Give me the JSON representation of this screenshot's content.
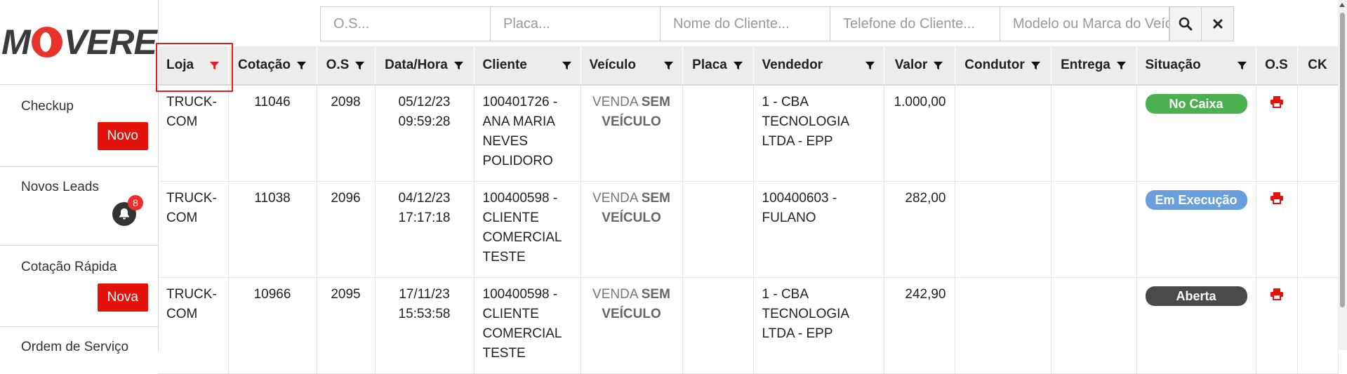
{
  "brand": {
    "logo_text_left": "M",
    "logo_text_right": "VERE"
  },
  "sidebar": {
    "items": [
      {
        "label": "Checkup",
        "button": "Novo"
      },
      {
        "label": "Novos Leads",
        "badge": "8"
      },
      {
        "label": "Cotação Rápida",
        "button": "Nova"
      },
      {
        "label": "Ordem de Serviço"
      }
    ]
  },
  "search": {
    "os_placeholder": "O.S...",
    "placa_placeholder": "Placa...",
    "cliente_placeholder": "Nome do Cliente...",
    "telefone_placeholder": "Telefone do Cliente...",
    "modelo_placeholder": "Modelo ou Marca do Veículo..."
  },
  "table": {
    "headers": [
      "Loja",
      "Cotação",
      "O.S",
      "Data/Hora",
      "Cliente",
      "Veículo",
      "Placa",
      "Vendedor",
      "Valor",
      "Condutor",
      "Entrega",
      "Situação",
      "O.S",
      "CK"
    ],
    "rows": [
      {
        "loja": "TRUCK-COM",
        "cotacao": "11046",
        "os": "2098",
        "data": "05/12/23",
        "hora": "09:59:28",
        "cliente": "100401726 - ANA MARIA NEVES POLIDORO",
        "veiculo_prefix": "VENDA",
        "veiculo_bold": "SEM VEÍCULO",
        "placa": "",
        "vendedor": "1 - CBA TECNOLOGIA LTDA - EPP",
        "valor": "1.000,00",
        "condutor": "",
        "entrega": "",
        "situacao": "No Caixa",
        "situacao_color": "#4caf50"
      },
      {
        "loja": "TRUCK-COM",
        "cotacao": "11038",
        "os": "2096",
        "data": "04/12/23",
        "hora": "17:17:18",
        "cliente": "100400598 - CLIENTE COMERCIAL TESTE",
        "veiculo_prefix": "VENDA",
        "veiculo_bold": "SEM VEÍCULO",
        "placa": "",
        "vendedor": "100400603 - FULANO",
        "valor": "282,00",
        "condutor": "",
        "entrega": "",
        "situacao": "Em Execução",
        "situacao_color": "#6a9fde"
      },
      {
        "loja": "TRUCK-COM",
        "cotacao": "10966",
        "os": "2095",
        "data": "17/11/23",
        "hora": "15:53:58",
        "cliente": "100400598 - CLIENTE COMERCIAL TESTE",
        "veiculo_prefix": "VENDA",
        "veiculo_bold": "SEM VEÍCULO",
        "placa": "",
        "vendedor": "1 - CBA TECNOLOGIA LTDA - EPP",
        "valor": "242,90",
        "condutor": "",
        "entrega": "",
        "situacao": "Aberta",
        "situacao_color": "#4a4a4a"
      }
    ]
  },
  "colors": {
    "accent_red": "#e3120b",
    "filter_active": "#e01e1e"
  }
}
